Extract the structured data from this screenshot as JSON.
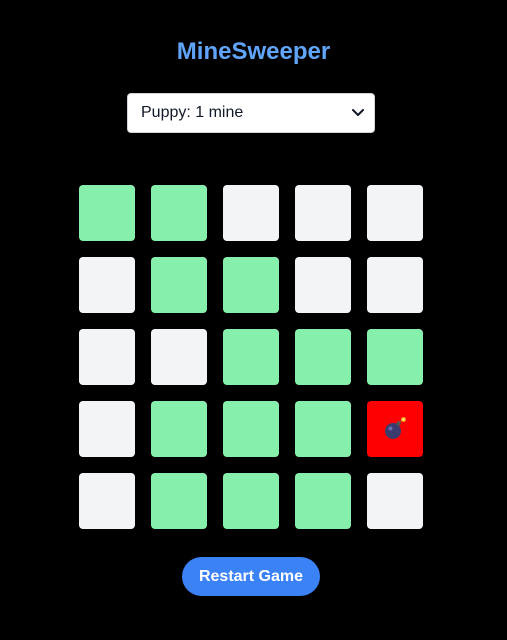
{
  "app": {
    "title": "MineSweeper",
    "accent_color": "#60a5fa"
  },
  "difficulty": {
    "selected": "Puppy: 1 mine"
  },
  "board": {
    "rows": 5,
    "cols": 5,
    "colors": {
      "hidden": "#f3f4f6",
      "revealed": "#86efac",
      "mine": "#ff0000"
    },
    "cells": [
      [
        "revealed",
        "revealed",
        "hidden",
        "hidden",
        "hidden"
      ],
      [
        "hidden",
        "revealed",
        "revealed",
        "hidden",
        "hidden"
      ],
      [
        "hidden",
        "hidden",
        "revealed",
        "revealed",
        "revealed"
      ],
      [
        "hidden",
        "revealed",
        "revealed",
        "revealed",
        "mine"
      ],
      [
        "hidden",
        "revealed",
        "revealed",
        "revealed",
        "hidden"
      ]
    ],
    "mine_icon": "bomb-icon"
  },
  "actions": {
    "restart_label": "Restart Game",
    "restart_color": "#3b82f6"
  }
}
